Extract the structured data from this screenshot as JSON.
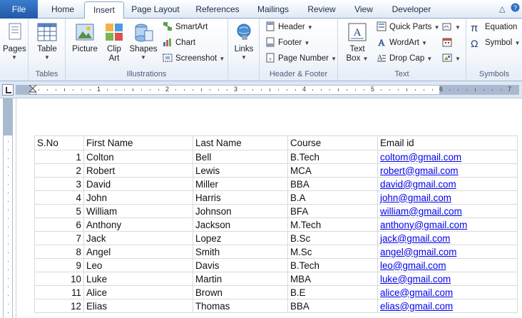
{
  "tabs": {
    "file": "File",
    "home": "Home",
    "insert": "Insert",
    "page_layout": "Page Layout",
    "references": "References",
    "mailings": "Mailings",
    "review": "Review",
    "view": "View",
    "developer": "Developer"
  },
  "ribbon": {
    "pages": {
      "pages_label": "Pages"
    },
    "tables": {
      "table_label": "Table",
      "group_label": "Tables"
    },
    "illustrations": {
      "picture_label": "Picture",
      "clip_art_label_1": "Clip",
      "clip_art_label_2": "Art",
      "shapes_label": "Shapes",
      "smartart_label": "SmartArt",
      "chart_label": "Chart",
      "screenshot_label": "Screenshot",
      "group_label": "Illustrations"
    },
    "links": {
      "links_label": "Links"
    },
    "header_footer": {
      "header_label": "Header",
      "footer_label": "Footer",
      "page_number_label": "Page Number",
      "group_label": "Header & Footer"
    },
    "text": {
      "text_box_label_1": "Text",
      "text_box_label_2": "Box",
      "quick_parts_label": "Quick Parts",
      "wordart_label": "WordArt",
      "drop_cap_label": "Drop Cap",
      "group_label": "Text"
    },
    "symbols": {
      "equation_label": "Equation",
      "symbol_label": "Symbol",
      "group_label": "Symbols"
    }
  },
  "ruler": {
    "numbers": [
      "1",
      "2",
      "3",
      "4",
      "5",
      "6",
      "7"
    ]
  },
  "table": {
    "headers": [
      "S.No",
      "First Name",
      "Last Name",
      "Course",
      "Email id"
    ],
    "rows": [
      [
        "1",
        "Colton",
        "Bell",
        "B.Tech",
        "coltom@gmail.com"
      ],
      [
        "2",
        "Robert",
        "Lewis",
        "MCA",
        "robert@gmail.com"
      ],
      [
        "3",
        "David",
        "Miller",
        "BBA",
        "david@gmail.com"
      ],
      [
        "4",
        "John",
        "Harris",
        "B.A",
        "john@gmail.com"
      ],
      [
        "5",
        "William",
        "Johnson",
        "BFA",
        "william@gmail.com"
      ],
      [
        "6",
        "Anthony",
        "Jackson",
        "M.Tech",
        "anthony@gmail.com"
      ],
      [
        "7",
        "Jack",
        "Lopez",
        "B.Sc",
        "jack@gmail.com"
      ],
      [
        "8",
        "Angel",
        "Smith",
        "M.Sc",
        "angel@gmail.com"
      ],
      [
        "9",
        "Leo",
        "Davis",
        "B.Tech",
        "leo@gmail.com"
      ],
      [
        "10",
        "Luke",
        "Martin",
        "MBA",
        "luke@gmail.com"
      ],
      [
        "11",
        "Alice",
        "Brown",
        "B.E",
        "alice@gmail.com"
      ],
      [
        "12",
        "Elias",
        "Thomas",
        "BBA",
        "elias@gmail.com"
      ]
    ]
  },
  "colors": {
    "file_tab": "#2a64b4",
    "link": "#0000ee",
    "ruler_margin": "#a9b9cf"
  }
}
